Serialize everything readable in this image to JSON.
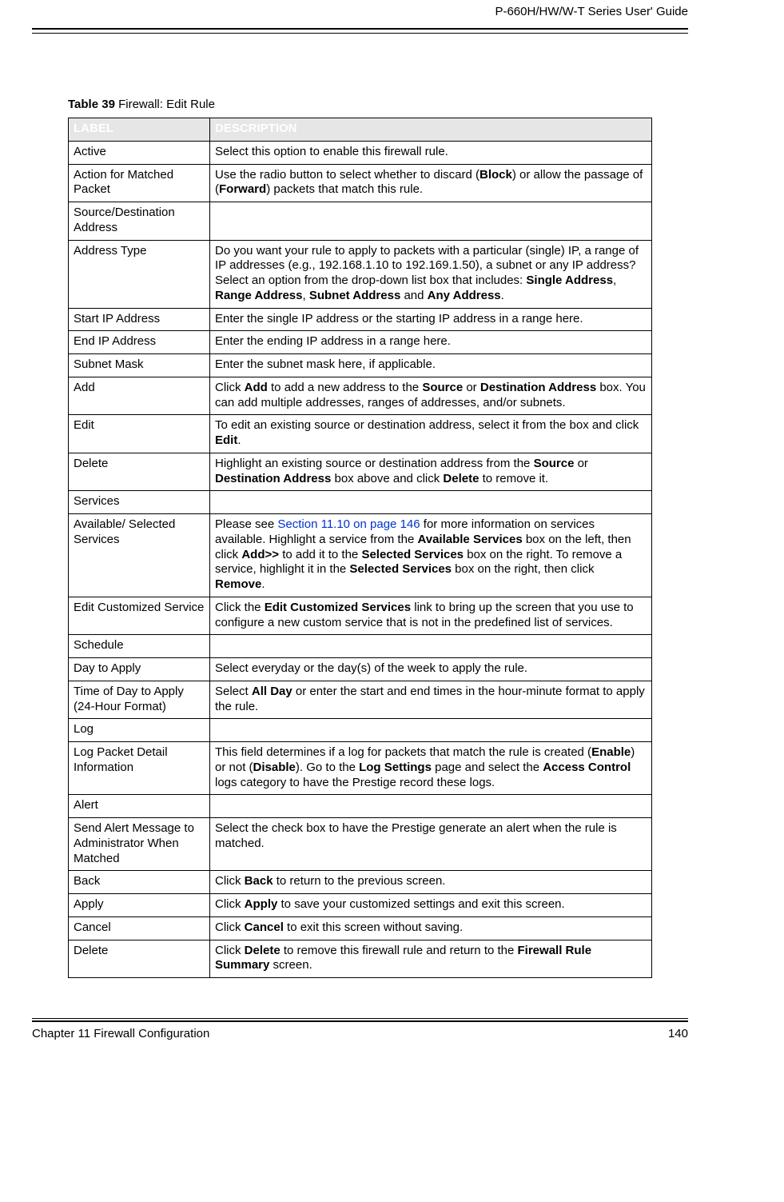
{
  "doc_header": "P-660H/HW/W-T Series User' Guide",
  "table_caption_prefix": "Table 39",
  "table_caption_title": "   Firewall: Edit Rule",
  "columns": {
    "label": "LABEL",
    "desc": "DESCRIPTION"
  },
  "rows": {
    "active": {
      "label": "Active",
      "desc_pre": "Select this option to enable this firewall rule."
    },
    "action": {
      "label": "Action for Matched Packet",
      "p1": "Use the radio button to select whether to discard (",
      "b1": "Block",
      "p2": ") or allow the passage of (",
      "b2": "Forward",
      "p3": ") packets that match this rule."
    },
    "srcdst": {
      "label": "Source/Destination Address",
      "desc": ""
    },
    "addrtype": {
      "label": "Address Type",
      "p1": "Do you want your rule to apply to packets with a particular (single) IP, a range of IP addresses (e.g., 192.168.1.10 to 192.169.1.50), a subnet or any IP address? Select an option from the drop-down list box that includes: ",
      "b1": "Single Address",
      "c1": ", ",
      "b2": "Range Address",
      "c2": ", ",
      "b3": "Subnet Address",
      "c3": " and ",
      "b4": "Any Address",
      "p2": "."
    },
    "startip": {
      "label": "Start IP Address",
      "desc": "Enter the single IP address or the starting IP address in a range here."
    },
    "endip": {
      "label": "End IP Address",
      "desc": "Enter the ending IP address in a range here."
    },
    "subnet": {
      "label": "Subnet Mask",
      "desc": "Enter the subnet mask here, if applicable."
    },
    "add": {
      "label": "Add",
      "p1": "Click ",
      "b1": "Add",
      "p2": " to add a new address to the ",
      "b2": "Source",
      "p3": " or ",
      "b3": "Destination Address",
      "p4": " box. You can add multiple addresses, ranges of addresses, and/or subnets."
    },
    "edit": {
      "label": "Edit",
      "p1": "To edit an existing source or destination address, select it from the box and click ",
      "b1": "Edit",
      "p2": "."
    },
    "delete1": {
      "label": "Delete",
      "p1": "Highlight an existing source or destination address from the ",
      "b1": "Source",
      "p2": " or ",
      "b2": "Destination Address",
      "p3": " box above and click ",
      "b3": "Delete",
      "p4": " to remove it."
    },
    "services": {
      "label": "Services",
      "desc": ""
    },
    "availsel": {
      "label": "Available/ Selected Services",
      "p1": "Please see ",
      "link": "Section 11.10 on page 146",
      "p2": " for more information on services available. Highlight a service from the ",
      "b1": "Available Services",
      "p3": " box on the left, then click ",
      "b2": "Add>>",
      "p4": " to add it to the ",
      "b3": "Selected Services",
      "p5": " box on the right. To remove a service, highlight it in the ",
      "b4": "Selected Services",
      "p6": " box on the right, then click ",
      "b5": "Remove",
      "p7": "."
    },
    "editcustom": {
      "label": "Edit Customized Service",
      "p1": "Click the ",
      "b1": "Edit Customized Services",
      "p2": " link to bring up the screen that you use to configure a new custom service that is not in the predefined list of services."
    },
    "schedule": {
      "label": "Schedule",
      "desc": ""
    },
    "day": {
      "label": "Day to Apply",
      "desc": "Select everyday or the day(s) of the week to apply the rule."
    },
    "time": {
      "label": "Time of Day to Apply (24-Hour Format)",
      "p1": "Select ",
      "b1": "All Day",
      "p2": " or enter the start and end times in the hour-minute format to apply the rule."
    },
    "log": {
      "label": "Log",
      "desc": ""
    },
    "logdetail": {
      "label": "Log Packet Detail Information",
      "p1": "This field determines if a log for packets that match the rule is created (",
      "b1": "Enable",
      "p2": ") or not (",
      "b2": "Disable",
      "p3": "). Go to the ",
      "b3": "Log Settings",
      "p4": " page and select the ",
      "b4": "Access Control",
      "p5": " logs category to have the Prestige record these logs."
    },
    "alert": {
      "label": "Alert",
      "desc": ""
    },
    "sendalert": {
      "label": "Send Alert Message to Administrator When Matched",
      "desc": "Select the check box to have the Prestige generate an alert when the rule is matched."
    },
    "back": {
      "label": "Back",
      "p1": "Click ",
      "b1": "Back",
      "p2": " to return to the previous screen."
    },
    "apply": {
      "label": "Apply",
      "p1": "Click ",
      "b1": "Apply",
      "p2": " to save your customized settings and exit this screen."
    },
    "cancel": {
      "label": "Cancel",
      "p1": "Click ",
      "b1": "Cancel",
      "p2": " to exit this screen without saving."
    },
    "delete2": {
      "label": "Delete",
      "p1": "Click ",
      "b1": "Delete",
      "p2": " to remove this firewall rule and return to the ",
      "b2": "Firewall Rule Summary",
      "p3": " screen."
    }
  },
  "footer": {
    "chapter": "Chapter 11 Firewall Configuration",
    "page": "140"
  }
}
